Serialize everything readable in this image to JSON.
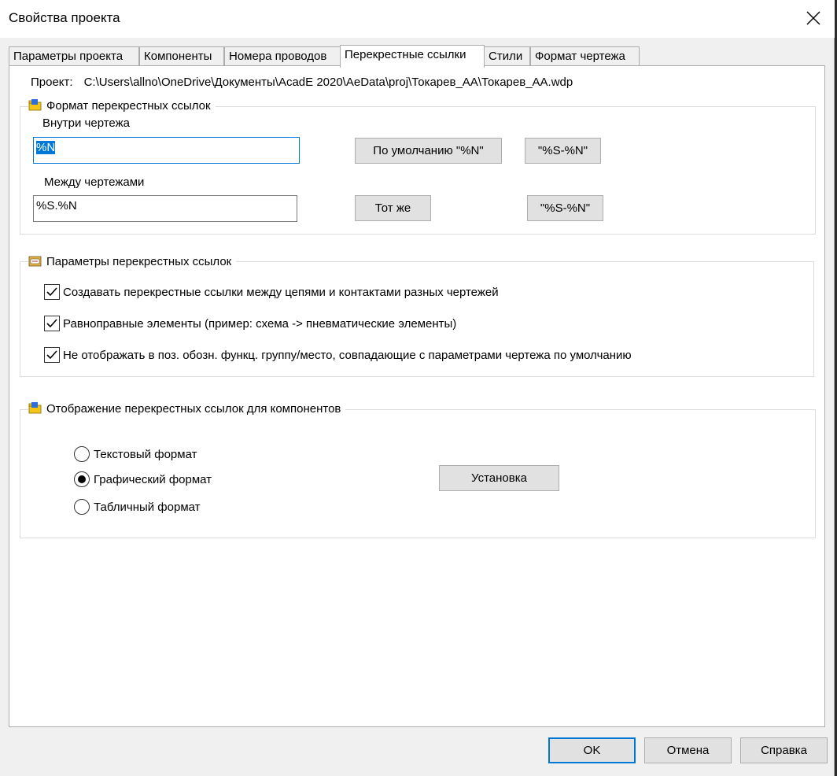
{
  "window": {
    "title": "Свойства проекта"
  },
  "tabs": [
    {
      "label": "Параметры проекта",
      "active": false
    },
    {
      "label": "Компоненты",
      "active": false
    },
    {
      "label": "Номера проводов",
      "active": false
    },
    {
      "label": "Перекрестные ссылки",
      "active": true
    },
    {
      "label": "Стили",
      "active": false
    },
    {
      "label": "Формат чертежа",
      "active": false
    }
  ],
  "project": {
    "label": "Проект:",
    "path": "C:\\Users\\allno\\OneDrive\\Документы\\AcadE 2020\\AeData\\proj\\Токарев_АА\\Токарев_АА.wdp"
  },
  "format_group": {
    "title": "Формат перекрестных ссылок",
    "within_label": "Внутри чертежа",
    "within_value": "%N",
    "within_default_button": "По умолчанию \"%N\"",
    "within_alt_button": "\"%S-%N\"",
    "between_label": "Между чертежами",
    "between_value": "%S.%N",
    "between_same_button": "Тот же",
    "between_alt_button": "\"%S-%N\""
  },
  "params_group": {
    "title": "Параметры перекрестных ссылок",
    "checkboxes": [
      {
        "label": "Создавать перекрестные ссылки между цепями и контактами разных чертежей",
        "checked": true
      },
      {
        "label": "Равноправные элементы (пример: схема -> пневматические элементы)",
        "checked": true
      },
      {
        "label": "Не отображать в поз. обозн. функц. группу/место, совпадающие с параметрами чертежа по умолчанию",
        "checked": true
      }
    ]
  },
  "display_group": {
    "title": "Отображение перекрестных ссылок для компонентов",
    "radios": [
      {
        "label": "Текстовый формат",
        "selected": false
      },
      {
        "label": "Графический формат",
        "selected": true
      },
      {
        "label": "Табличный формат",
        "selected": false
      }
    ],
    "setup_button": "Установка"
  },
  "footer": {
    "ok": "OK",
    "cancel": "Отмена",
    "help": "Справка"
  },
  "colors": {
    "accent": "#0078d7",
    "icon_yellow": "#f5c518"
  }
}
